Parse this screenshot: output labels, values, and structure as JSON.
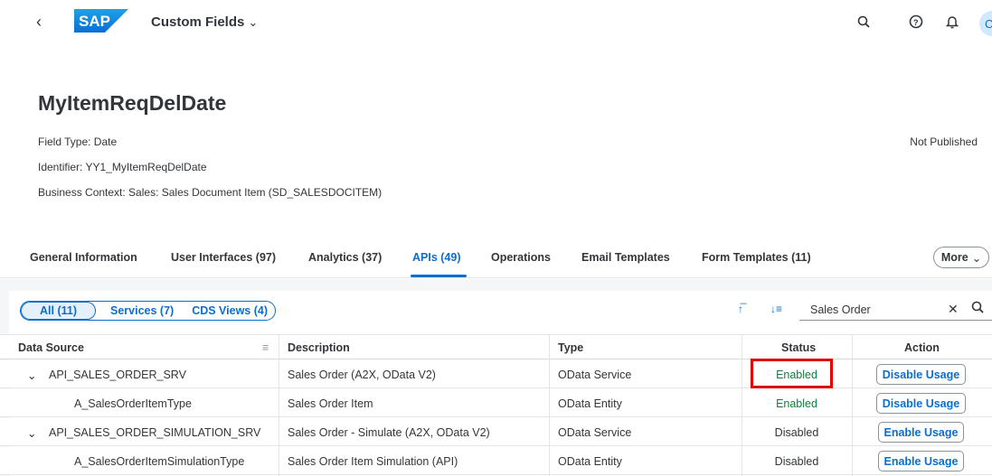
{
  "shell": {
    "app_title": "Custom Fields",
    "logo_text": "SAP",
    "avatar_initial": "C"
  },
  "header": {
    "title": "MyItemReqDelDate",
    "field_type": "Field Type: Date",
    "identifier": "Identifier: YY1_MyItemReqDelDate",
    "business_context": "Business Context: Sales: Sales Document Item (SD_SALESDOCITEM)",
    "status": "Not Published"
  },
  "tabs": [
    {
      "label": "General Information"
    },
    {
      "label": "User Interfaces (97)"
    },
    {
      "label": "Analytics (37)"
    },
    {
      "label": "APIs (49)"
    },
    {
      "label": "Operations"
    },
    {
      "label": "Email Templates"
    },
    {
      "label": "Form Templates (11)"
    }
  ],
  "more_label": "More",
  "filters": {
    "segments": [
      "All (11)",
      "Services (7)",
      "CDS Views (4)"
    ],
    "search_value": "Sales Order"
  },
  "table": {
    "columns": [
      "Data Source",
      "Description",
      "Type",
      "Status",
      "Action"
    ],
    "rows": [
      {
        "source": "API_SALES_ORDER_SRV",
        "description": "Sales Order (A2X, OData V2)",
        "type": "OData Service",
        "status": "Enabled",
        "action": "Disable Usage"
      },
      {
        "source": "A_SalesOrderItemType",
        "description": "Sales Order Item",
        "type": "OData Entity",
        "status": "Enabled",
        "action": "Disable Usage"
      },
      {
        "source": "API_SALES_ORDER_SIMULATION_SRV",
        "description": "Sales Order - Simulate (A2X, OData V2)",
        "type": "OData Service",
        "status": "Disabled",
        "action": "Enable Usage"
      },
      {
        "source": "A_SalesOrderItemSimulationType",
        "description": "Sales Order Item Simulation (API)",
        "type": "OData Entity",
        "status": "Disabled",
        "action": "Enable Usage"
      }
    ]
  },
  "colors": {
    "accent": "#0a6ed1",
    "enabled": "#107e3e",
    "highlight": "#e00000"
  }
}
